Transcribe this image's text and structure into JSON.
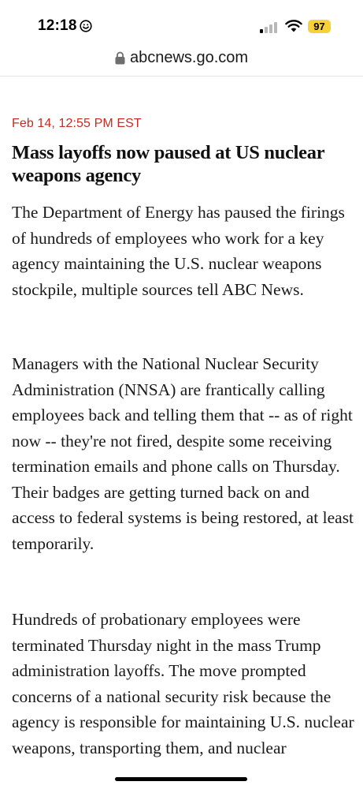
{
  "status_bar": {
    "time": "12:18",
    "battery": "97",
    "battery_color": "#f7d13a"
  },
  "browser": {
    "url": "abcnews.go.com"
  },
  "article": {
    "timestamp": "Feb 14, 12:55 PM EST",
    "headline": "Mass layoffs now paused at US nuclear weapons agency",
    "paragraphs": [
      "The Department of Energy has paused the firings of hundreds of employees who work for a key agency maintaining the U.S. nuclear weapons stockpile, multiple sources tell ABC News.",
      "Managers with the National Nuclear Security Administration (NNSA) are frantically calling employees back and telling them that -- as of right now -- they're not fired, despite some receiving termination emails and phone calls on Thursday. Their badges are getting turned back on and access to federal systems is being restored, at least temporarily.",
      "Hundreds of probationary employees were terminated Thursday night in the mass Trump administration layoffs. The move prompted concerns of a national security risk because the agency is responsible for maintaining U.S. nuclear weapons, transporting them, and nuclear"
    ]
  },
  "icons": {
    "emoji": "smiley-icon",
    "signal": "cellular-signal-icon",
    "wifi": "wifi-icon",
    "lock": "lock-icon"
  },
  "colors": {
    "accent": "#c22d24",
    "text": "#1a1a1a"
  }
}
